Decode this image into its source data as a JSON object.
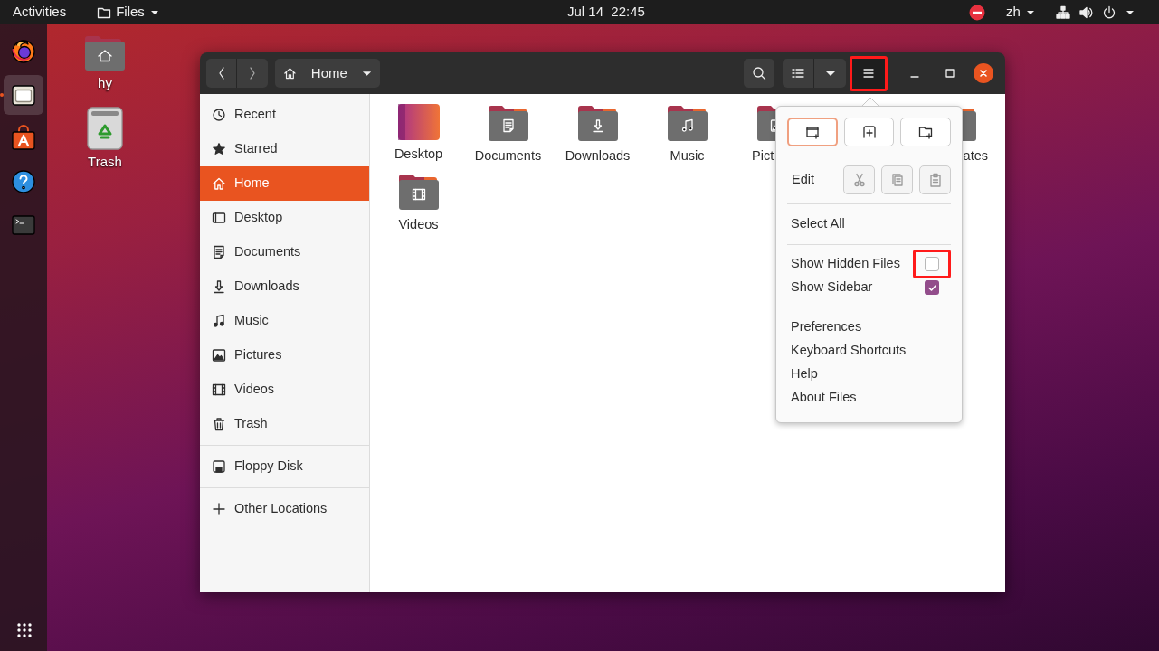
{
  "top_bar": {
    "activities": "Activities",
    "app_menu": "Files",
    "clock": "Jul 14  22:45",
    "input_method": "zh"
  },
  "dock": [
    {
      "kind": "browser",
      "running": false
    },
    {
      "kind": "files",
      "running": true
    },
    {
      "kind": "software",
      "running": false
    },
    {
      "kind": "help",
      "running": false
    },
    {
      "kind": "terminal",
      "running": false
    }
  ],
  "desktop_icons": [
    {
      "label": "hy",
      "kind": "home"
    },
    {
      "label": "Trash",
      "kind": "trash"
    }
  ],
  "window": {
    "location": "Home",
    "menu_button_highlighted": true
  },
  "sidebar": {
    "sections": [
      [
        {
          "label": "Recent",
          "kind": "recent",
          "selected": false
        },
        {
          "label": "Starred",
          "kind": "starred",
          "selected": false
        },
        {
          "label": "Home",
          "kind": "home",
          "selected": true
        },
        {
          "label": "Desktop",
          "kind": "desktop",
          "selected": false
        },
        {
          "label": "Documents",
          "kind": "documents",
          "selected": false
        },
        {
          "label": "Downloads",
          "kind": "downloads",
          "selected": false
        },
        {
          "label": "Music",
          "kind": "music",
          "selected": false
        },
        {
          "label": "Pictures",
          "kind": "pictures",
          "selected": false
        },
        {
          "label": "Videos",
          "kind": "videos",
          "selected": false
        },
        {
          "label": "Trash",
          "kind": "trash",
          "selected": false
        }
      ],
      [
        {
          "label": "Floppy Disk",
          "kind": "floppy",
          "selected": false
        }
      ],
      [
        {
          "label": "Other Locations",
          "kind": "plus",
          "selected": false
        }
      ]
    ]
  },
  "folders": [
    {
      "label": "Desktop",
      "kind": "desktop",
      "cut_right": false,
      "cut_left": false
    },
    {
      "label": "Documents",
      "kind": "documents",
      "cut_right": false,
      "cut_left": false
    },
    {
      "label": "Downloads",
      "kind": "downloads",
      "cut_right": false,
      "cut_left": false
    },
    {
      "label": "Music",
      "kind": "music",
      "cut_right": false,
      "cut_left": false
    },
    {
      "label": "Pict",
      "kind": "pictures",
      "cut_right": true,
      "cut_left": false
    },
    {
      "label": "ates",
      "kind": "templates",
      "cut_right": false,
      "cut_left": true
    },
    {
      "label": "Videos",
      "kind": "videos",
      "cut_right": false,
      "cut_left": false
    }
  ],
  "menu": {
    "new_buttons": [
      {
        "kind": "new-window",
        "focused": true
      },
      {
        "kind": "new-tab",
        "focused": false
      },
      {
        "kind": "new-folder",
        "focused": false
      }
    ],
    "edit_label": "Edit",
    "edit_buttons": [
      {
        "kind": "cut"
      },
      {
        "kind": "copy"
      },
      {
        "kind": "paste"
      }
    ],
    "select_all": "Select All",
    "toggles": [
      {
        "label": "Show Hidden Files",
        "checked": false,
        "highlighted": true
      },
      {
        "label": "Show Sidebar",
        "checked": true,
        "highlighted": false
      }
    ],
    "items": [
      "Preferences",
      "Keyboard Shortcuts",
      "Help",
      "About Files"
    ]
  }
}
